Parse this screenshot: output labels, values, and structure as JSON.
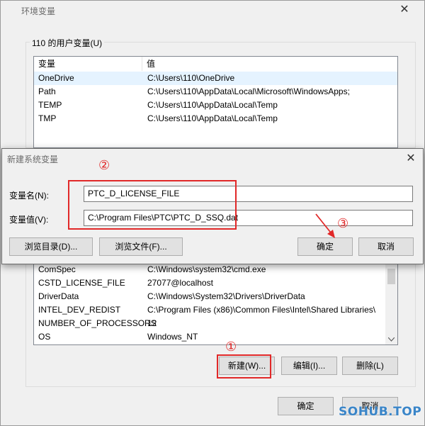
{
  "main": {
    "title": "环境变量",
    "user_group_label": "110 的用户变量(U)",
    "user_columns": [
      "变量",
      "值"
    ],
    "user_vars": [
      {
        "name": "OneDrive",
        "value": "C:\\Users\\110\\OneDrive"
      },
      {
        "name": "Path",
        "value": "C:\\Users\\110\\AppData\\Local\\Microsoft\\WindowsApps;"
      },
      {
        "name": "TEMP",
        "value": "C:\\Users\\110\\AppData\\Local\\Temp"
      },
      {
        "name": "TMP",
        "value": "C:\\Users\\110\\AppData\\Local\\Temp"
      }
    ],
    "system_vars": [
      {
        "name": "ComSpec",
        "value": "C:\\Windows\\system32\\cmd.exe"
      },
      {
        "name": "CSTD_LICENSE_FILE",
        "value": "27077@localhost"
      },
      {
        "name": "DriverData",
        "value": "C:\\Windows\\System32\\Drivers\\DriverData"
      },
      {
        "name": "INTEL_DEV_REDIST",
        "value": "C:\\Program Files (x86)\\Common Files\\Intel\\Shared Libraries\\"
      },
      {
        "name": "NUMBER_OF_PROCESSORS",
        "value": "12"
      },
      {
        "name": "OS",
        "value": "Windows_NT"
      }
    ],
    "new_button": "新建(W)...",
    "edit_button": "编辑(I)...",
    "delete_button": "删除(L)",
    "ok_button": "确定",
    "cancel_button": "取消"
  },
  "dialog": {
    "title": "新建系统变量",
    "name_label": "变量名(N):",
    "name_value": "PTC_D_LICENSE_FILE",
    "value_label": "变量值(V):",
    "value_value": "C:\\Program Files\\PTC\\PTC_D_SSQ.dat",
    "browse_dir_button": "浏览目录(D)...",
    "browse_file_button": "浏览文件(F)...",
    "ok_button": "确定",
    "cancel_button": "取消"
  },
  "annotations": {
    "step1": "①",
    "step2": "②",
    "step3": "③",
    "accent": "#e12828"
  },
  "icons": {
    "close": "close-icon",
    "scroll_up": "chevron-up-icon",
    "scroll_down": "chevron-down-icon"
  },
  "watermark": "SOHUB.TOP"
}
